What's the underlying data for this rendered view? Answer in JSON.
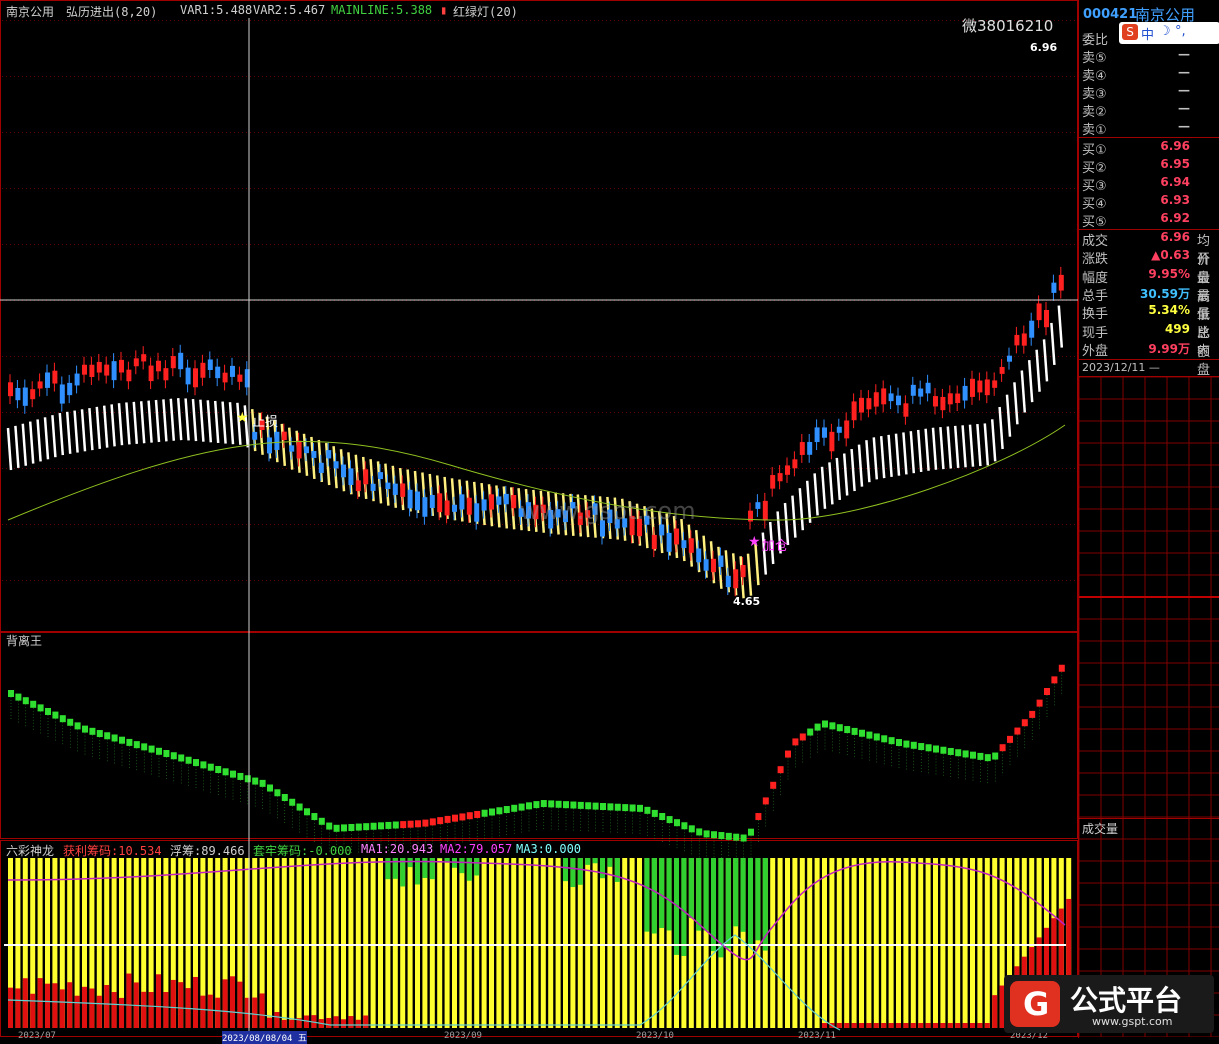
{
  "main_panel": {
    "stock_name": "南京公用",
    "indicator": "弘历进出(8,20)",
    "var1": "VAR1:5.488",
    "var2": "VAR2:5.467",
    "mainline": "MAINLINE:5.388",
    "light": "红绿灯(20)",
    "watermark_contact": "微38016210",
    "price_high_label": "6.96",
    "price_low_label": "4.65",
    "signal_sell": "止损",
    "signal_buy": "加仓",
    "site_watermark": "www.gspt.com"
  },
  "mid_panel": {
    "title": "背离王"
  },
  "bottom_panel": {
    "title": "六彩神龙",
    "profit": "获利筹码:10.534",
    "float": "浮筹:89.466",
    "trapped": "套牢筹码:-0.000",
    "ma1": "MA1:20.943",
    "ma2": "MA2:79.057",
    "ma3": "MA3:0.000"
  },
  "date_axis": [
    "2023/07",
    "2023/08/08/04 五",
    "2023/09",
    "2023/10",
    "2023/11",
    "2023/12"
  ],
  "quote": {
    "code": "000421",
    "name": "南京公用",
    "weibi_label": "委比",
    "sell": [
      {
        "label": "卖⑤",
        "value": "—"
      },
      {
        "label": "卖④",
        "value": "—"
      },
      {
        "label": "卖③",
        "value": "—"
      },
      {
        "label": "卖②",
        "value": "—"
      },
      {
        "label": "卖①",
        "value": "—"
      }
    ],
    "buy": [
      {
        "label": "买①",
        "value": "6.96"
      },
      {
        "label": "买②",
        "value": "6.95"
      },
      {
        "label": "买③",
        "value": "6.94"
      },
      {
        "label": "买④",
        "value": "6.93"
      },
      {
        "label": "买⑤",
        "value": "6.92"
      }
    ],
    "stats": [
      {
        "label": "成交",
        "value": "6.96",
        "extra": "均价",
        "color": "#ff4060"
      },
      {
        "label": "涨跌",
        "value": "▲0.63",
        "extra": "开盘",
        "color": "#ff4060"
      },
      {
        "label": "幅度",
        "value": "9.95%",
        "extra": "最高",
        "color": "#ff4060"
      },
      {
        "label": "总手",
        "value": "30.59万",
        "extra": "最低",
        "color": "#40c0ff"
      },
      {
        "label": "换手",
        "value": "5.34%",
        "extra": "量比",
        "color": "#ffff40"
      },
      {
        "label": "现手",
        "value": "499",
        "extra": "总额",
        "color": "#ffff40"
      },
      {
        "label": "外盘",
        "value": "9.99万",
        "extra": "内盘",
        "color": "#ff4060"
      }
    ],
    "time_date": "2023/12/11",
    "volume_label": "成交量"
  },
  "logo": {
    "title": "公式平台",
    "url": "www.gspt.com"
  }
}
